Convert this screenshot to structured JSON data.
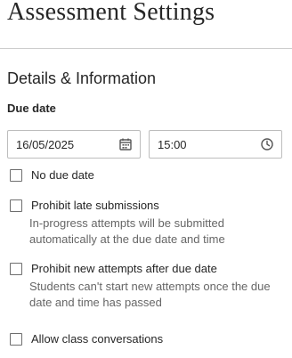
{
  "page": {
    "title": "Assessment Settings"
  },
  "details": {
    "section_title": "Details & Information",
    "due_date_label": "Due date",
    "date_value": "16/05/2025",
    "date_icon": "calendar-icon",
    "time_value": "15:00",
    "time_icon": "clock-icon"
  },
  "options": [
    {
      "label": "No due date",
      "help": "",
      "checked": false
    },
    {
      "label": "Prohibit late submissions",
      "help": "In-progress attempts will be submitted automatically at the due date and time",
      "checked": false
    },
    {
      "label": "Prohibit new attempts after due date",
      "help": "Students can't start new attempts once the due date and time has passed",
      "checked": false
    },
    {
      "label": "Allow class conversations",
      "help": "",
      "checked": false
    }
  ],
  "colors": {
    "text": "#262626",
    "help_text": "#666666",
    "border": "#bdbdbd"
  }
}
